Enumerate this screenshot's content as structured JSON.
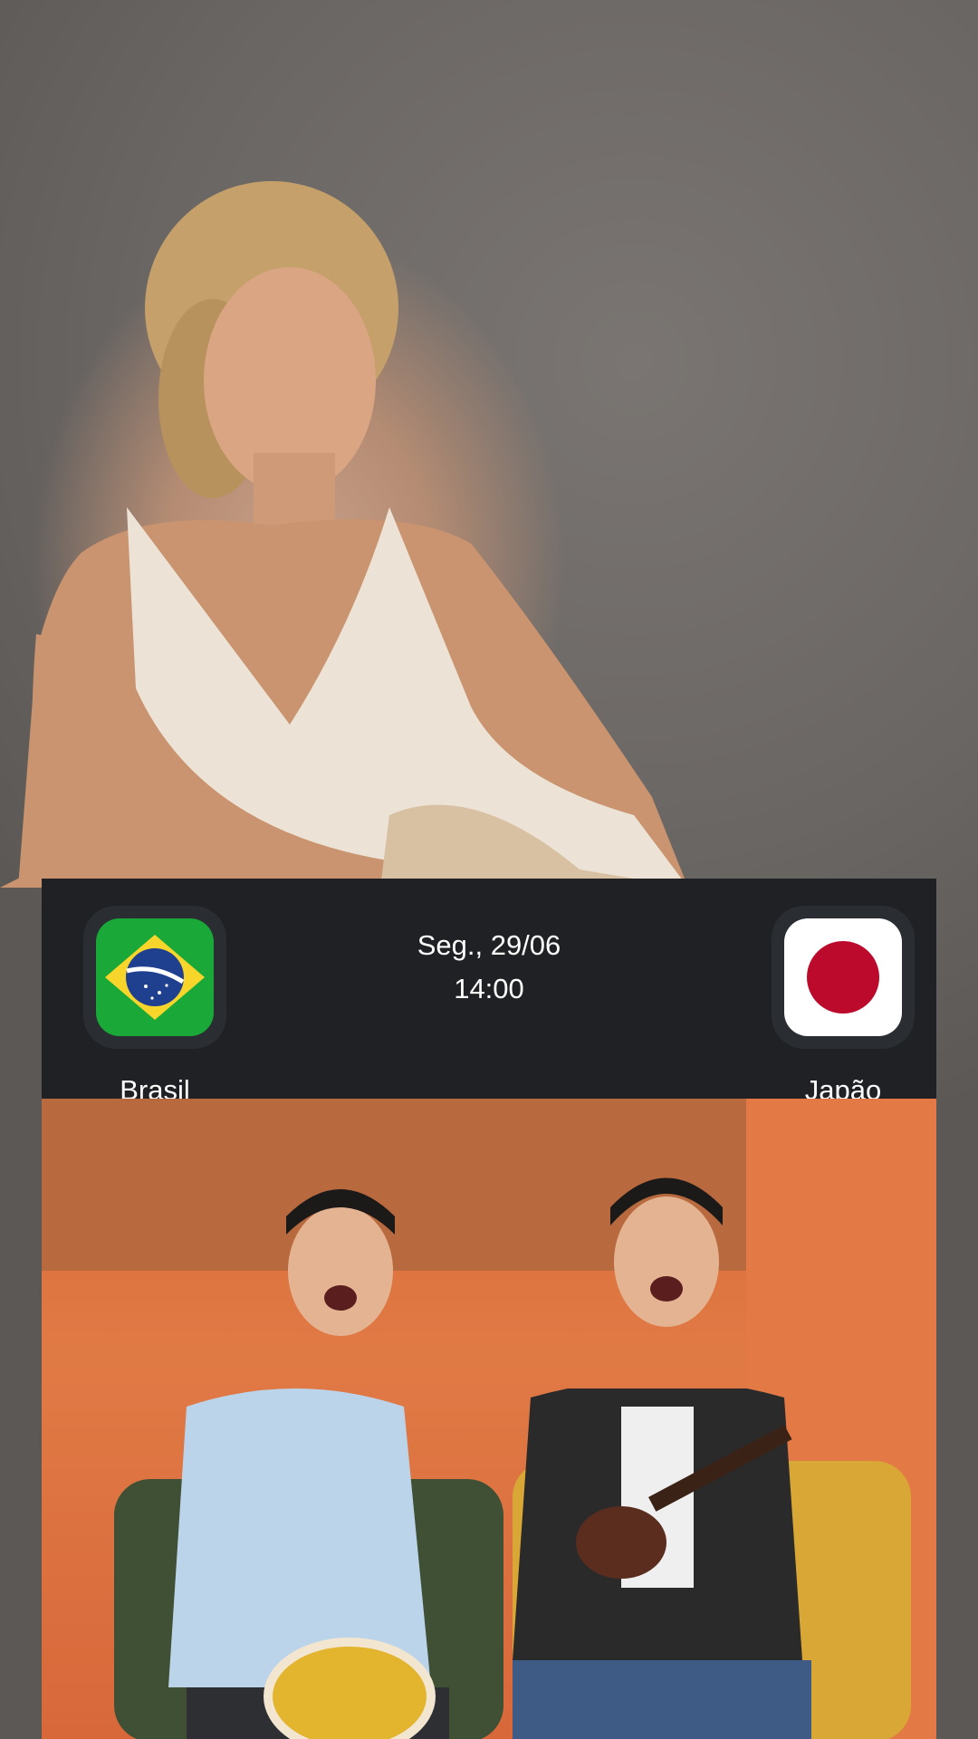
{
  "match": {
    "date": "Seg., 29/06",
    "time": "14:00",
    "home_team": {
      "name": "Brasil",
      "flag": "brazil-flag-icon"
    },
    "away_team": {
      "name": "Japão",
      "flag": "japan-flag-icon"
    }
  },
  "colors": {
    "card_background": "#1f2124",
    "text": "#ffffff",
    "video_background": "#e07a45"
  }
}
